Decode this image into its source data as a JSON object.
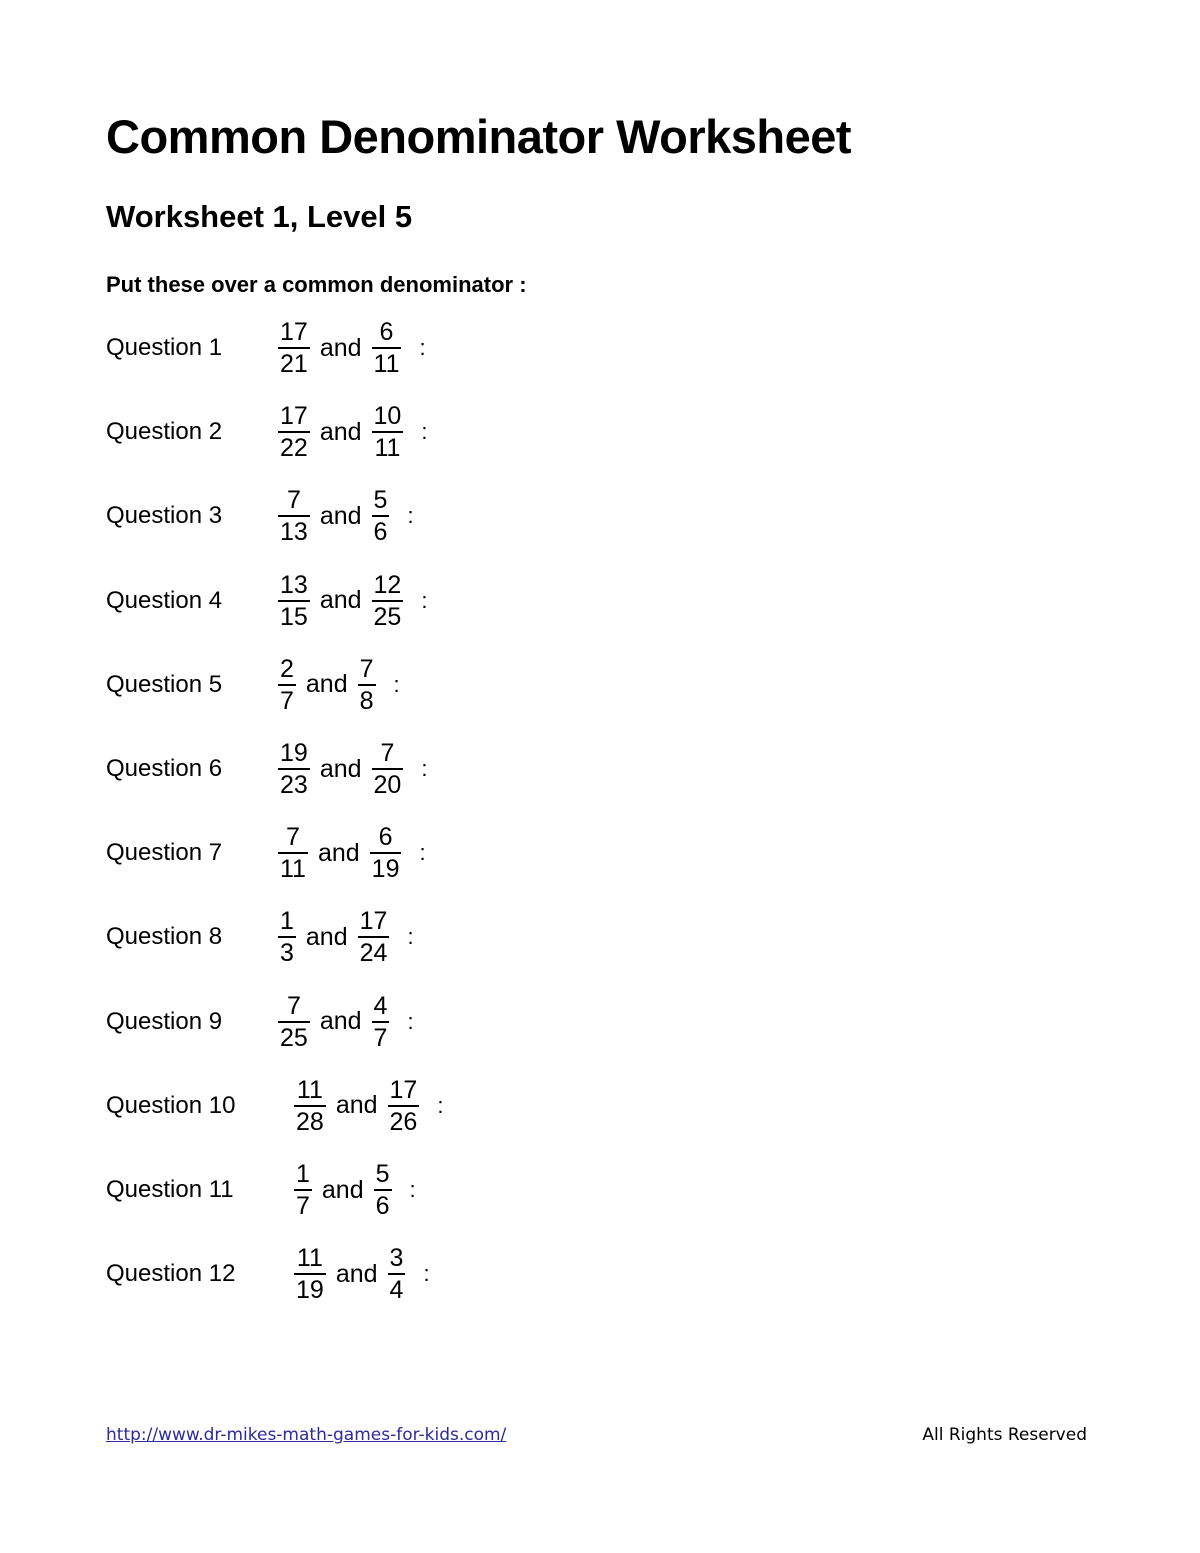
{
  "document": {
    "title": "Common Denominator Worksheet",
    "subtitle": "Worksheet 1, Level 5",
    "instruction": "Put these over a common denominator :"
  },
  "questions": [
    {
      "label": "Question 1",
      "a": {
        "num": "17",
        "den": "21"
      },
      "b": {
        "num": "6",
        "den": "11"
      },
      "joiner": "and",
      "suffix": ":"
    },
    {
      "label": "Question 2",
      "a": {
        "num": "17",
        "den": "22"
      },
      "b": {
        "num": "10",
        "den": "11"
      },
      "joiner": "and",
      "suffix": ":"
    },
    {
      "label": "Question 3",
      "a": {
        "num": "7",
        "den": "13"
      },
      "b": {
        "num": "5",
        "den": "6"
      },
      "joiner": "and",
      "suffix": ":"
    },
    {
      "label": "Question 4",
      "a": {
        "num": "13",
        "den": "15"
      },
      "b": {
        "num": "12",
        "den": "25"
      },
      "joiner": "and",
      "suffix": ":"
    },
    {
      "label": "Question 5",
      "a": {
        "num": "2",
        "den": "7"
      },
      "b": {
        "num": "7",
        "den": "8"
      },
      "joiner": "and",
      "suffix": ":"
    },
    {
      "label": "Question 6",
      "a": {
        "num": "19",
        "den": "23"
      },
      "b": {
        "num": "7",
        "den": "20"
      },
      "joiner": "and",
      "suffix": ":"
    },
    {
      "label": "Question 7",
      "a": {
        "num": "7",
        "den": "11"
      },
      "b": {
        "num": "6",
        "den": "19"
      },
      "joiner": "and",
      "suffix": ":"
    },
    {
      "label": "Question 8",
      "a": {
        "num": "1",
        "den": "3"
      },
      "b": {
        "num": "17",
        "den": "24"
      },
      "joiner": "and",
      "suffix": ":"
    },
    {
      "label": "Question 9",
      "a": {
        "num": "7",
        "den": "25"
      },
      "b": {
        "num": "4",
        "den": "7"
      },
      "joiner": "and",
      "suffix": ":"
    },
    {
      "label": "Question 10",
      "a": {
        "num": "11",
        "den": "28"
      },
      "b": {
        "num": "17",
        "den": "26"
      },
      "joiner": "and",
      "suffix": ":"
    },
    {
      "label": "Question 11",
      "a": {
        "num": "1",
        "den": "7"
      },
      "b": {
        "num": "5",
        "den": "6"
      },
      "joiner": "and",
      "suffix": ":"
    },
    {
      "label": "Question 12",
      "a": {
        "num": "11",
        "den": "19"
      },
      "b": {
        "num": "3",
        "den": "4"
      },
      "joiner": "and",
      "suffix": ":"
    }
  ],
  "footer": {
    "link_text": "http://www.dr-mikes-math-games-for-kids.com/",
    "rights": "All Rights Reserved",
    "link_color": "#2b2b9b"
  }
}
